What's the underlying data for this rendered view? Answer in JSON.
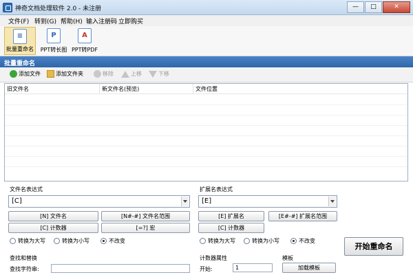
{
  "window": {
    "title": "神奇文档处理软件 2.0 - 未注册",
    "minimize": "—",
    "maximize": "□",
    "close": "✕"
  },
  "menu": [
    "文件(F)",
    "转到(G)",
    "帮助(H)",
    "输入注册码",
    "立即购买"
  ],
  "toolbar": {
    "tools": [
      "批量重命名",
      "PPT转长图",
      "PPT转PDF"
    ],
    "active_tool": "批量重命名"
  },
  "section_title": "批量重命名",
  "list_toolbar": {
    "add_file": "添加文件",
    "add_folder": "添加文件夹",
    "remove": "移除",
    "move_up": "上移",
    "move_down": "下移"
  },
  "file_list": {
    "columns": [
      "旧文件名",
      "新文件名(预览)",
      "文件位置"
    ],
    "rows": []
  },
  "filename_expr": {
    "title": "文件名表达式",
    "value": "[C]",
    "buttons": [
      "[N] 文件名",
      "[N#-#] 文件名范围",
      "[C] 计数器",
      "[=?] 宏"
    ],
    "case_options": [
      "转换为大写",
      "转换为小写",
      "不改变"
    ],
    "case_selected": "不改变"
  },
  "ext_expr": {
    "title": "扩展名表达式",
    "value": "[E]",
    "buttons": [
      "[E] 扩展名",
      "[E#-#] 扩展名范围",
      "[C] 计数器"
    ],
    "case_options": [
      "转换为大写",
      "转换为小写",
      "不改变"
    ],
    "case_selected": "不改变"
  },
  "start_button": "开始重命名",
  "find_replace": {
    "title": "查找和替换",
    "find_label": "查找字符串:",
    "find_value": ""
  },
  "counter": {
    "title": "计数器属性",
    "start_label": "开始:",
    "start_value": "1"
  },
  "template": {
    "title": "模板",
    "load_button": "加载模板"
  }
}
